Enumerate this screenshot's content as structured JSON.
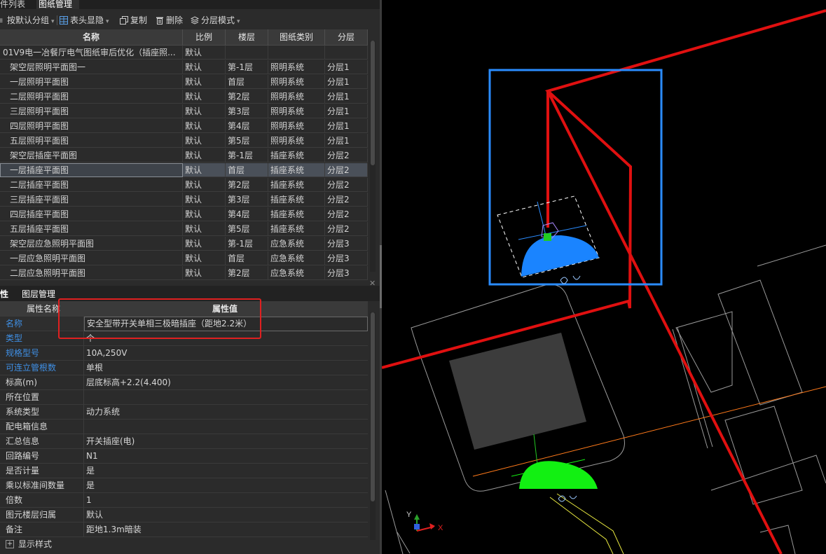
{
  "tabs": {
    "items": [
      {
        "label": "件列表",
        "active": false
      },
      {
        "label": "图纸管理",
        "active": true
      }
    ]
  },
  "toolbar": {
    "group_by_default": "按默认分组",
    "header_visibility": "表头显隐",
    "copy": "复制",
    "delete": "删除",
    "layer_mode": "分层模式"
  },
  "drawing_table": {
    "columns": [
      "名称",
      "比例",
      "楼层",
      "图纸类别",
      "分层"
    ],
    "rows": [
      {
        "name": "01V9电一冶餐厅电气图纸审后优化（插座照...",
        "scale": "默认",
        "floor": "",
        "category": "",
        "layer": "",
        "selected": false
      },
      {
        "name": "架空层照明平面图一",
        "scale": "默认",
        "floor": "第-1层",
        "category": "照明系统",
        "layer": "分层1",
        "selected": false
      },
      {
        "name": "一层照明平面图",
        "scale": "默认",
        "floor": "首层",
        "category": "照明系统",
        "layer": "分层1",
        "selected": false
      },
      {
        "name": "二层照明平面图",
        "scale": "默认",
        "floor": "第2层",
        "category": "照明系统",
        "layer": "分层1",
        "selected": false
      },
      {
        "name": "三层照明平面图",
        "scale": "默认",
        "floor": "第3层",
        "category": "照明系统",
        "layer": "分层1",
        "selected": false
      },
      {
        "name": "四层照明平面图",
        "scale": "默认",
        "floor": "第4层",
        "category": "照明系统",
        "layer": "分层1",
        "selected": false
      },
      {
        "name": "五层照明平面图",
        "scale": "默认",
        "floor": "第5层",
        "category": "照明系统",
        "layer": "分层1",
        "selected": false
      },
      {
        "name": "架空层插座平面图",
        "scale": "默认",
        "floor": "第-1层",
        "category": "插座系统",
        "layer": "分层2",
        "selected": false
      },
      {
        "name": "一层插座平面图",
        "scale": "默认",
        "floor": "首层",
        "category": "插座系统",
        "layer": "分层2",
        "selected": true
      },
      {
        "name": "二层插座平面图",
        "scale": "默认",
        "floor": "第2层",
        "category": "插座系统",
        "layer": "分层2",
        "selected": false
      },
      {
        "name": "三层插座平面图",
        "scale": "默认",
        "floor": "第3层",
        "category": "插座系统",
        "layer": "分层2",
        "selected": false
      },
      {
        "name": "四层插座平面图",
        "scale": "默认",
        "floor": "第4层",
        "category": "插座系统",
        "layer": "分层2",
        "selected": false
      },
      {
        "name": "五层插座平面图",
        "scale": "默认",
        "floor": "第5层",
        "category": "插座系统",
        "layer": "分层2",
        "selected": false
      },
      {
        "name": "架空层应急照明平面图",
        "scale": "默认",
        "floor": "第-1层",
        "category": "应急系统",
        "layer": "分层3",
        "selected": false
      },
      {
        "name": "一层应急照明平面图",
        "scale": "默认",
        "floor": "首层",
        "category": "应急系统",
        "layer": "分层3",
        "selected": false
      },
      {
        "name": "二层应急照明平面图",
        "scale": "默认",
        "floor": "第2层",
        "category": "应急系统",
        "layer": "分层3",
        "selected": false
      }
    ]
  },
  "props_tabs": {
    "properties": "性",
    "layer_management": "图层管理"
  },
  "properties": {
    "header_name": "属性名称",
    "header_value": "属性值",
    "rows": [
      {
        "name": "名称",
        "value": "安全型带开关单相三极暗插座（距地2.2米）",
        "link": true
      },
      {
        "name": "类型",
        "value": "个",
        "link": true
      },
      {
        "name": "规格型号",
        "value": "10A,250V",
        "link": true
      },
      {
        "name": "可连立管根数",
        "value": "单根",
        "link": true
      },
      {
        "name": "标高(m)",
        "value": "层底标高+2.2(4.400)",
        "link": false
      },
      {
        "name": "所在位置",
        "value": "",
        "link": false
      },
      {
        "name": "系统类型",
        "value": "动力系统",
        "link": false
      },
      {
        "name": "配电箱信息",
        "value": "",
        "link": false
      },
      {
        "name": "汇总信息",
        "value": "开关插座(电)",
        "link": false
      },
      {
        "name": "回路编号",
        "value": "N1",
        "link": false
      },
      {
        "name": "是否计量",
        "value": "是",
        "link": false
      },
      {
        "name": "乘以标准间数量",
        "value": "是",
        "link": false
      },
      {
        "name": "倍数",
        "value": "1",
        "link": false
      },
      {
        "name": "图元楼层归属",
        "value": "默认",
        "link": false
      },
      {
        "name": "备注",
        "value": "距地1.3m暗装",
        "link": false
      }
    ],
    "display_style": "显示样式",
    "expand_symbol": "+"
  },
  "canvas": {
    "axis_y": "Y",
    "axis_x": "X",
    "colors": {
      "background": "#000000",
      "wire": "#e01010",
      "selection": "#2a8cff",
      "socket_selected": "#1a84ff",
      "socket_normal": "#12f012",
      "grip": "#22cc22",
      "outline": "#9a9a9a",
      "box_fill": "#3c3c3c",
      "orange_line": "#ff7a1a",
      "yellow_line": "#e8e840"
    }
  }
}
